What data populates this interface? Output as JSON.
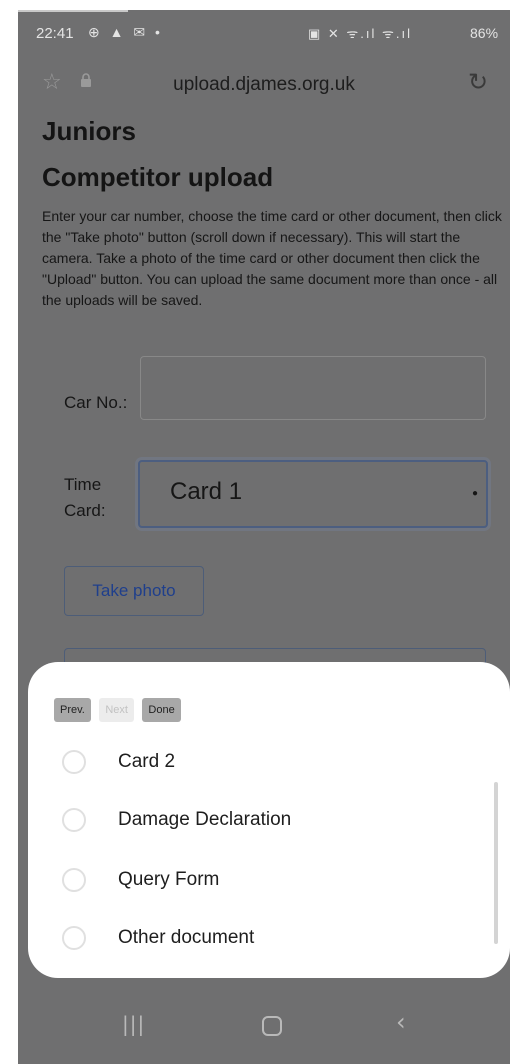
{
  "status_bar": {
    "time": "22:41",
    "left_icons": "⊕ ▲ ✉ •",
    "right_icons": "▣ ✕ ᯤ.ıl ᯤ.ıl",
    "battery": "86%"
  },
  "url_bar": {
    "url": "upload.djames.org.uk",
    "star_icon": "☆",
    "lock_icon": "🔒",
    "reload_icon": "↻"
  },
  "page": {
    "heading": "Juniors",
    "subheading": "Competitor upload",
    "instructions": "Enter your car number, choose the time card or other document, then click the \"Take photo\" button (scroll down if necessary). This will start the camera. Take a photo of the time card or other document then click the \"Upload\" button. You can upload the same document more than once - all the uploads will be saved.",
    "car_label": "Car No.:",
    "car_value": "",
    "card_label": "Time Card:",
    "card_value": "Card 1",
    "take_photo_label": "Take photo"
  },
  "picker": {
    "toolbar": {
      "prev": "Prev.",
      "next": "Next",
      "done": "Done"
    },
    "options": [
      {
        "label": "Card 2",
        "selected": false
      },
      {
        "label": "Damage Declaration",
        "selected": false
      },
      {
        "label": "Query Form",
        "selected": false
      },
      {
        "label": "Other document",
        "selected": false
      }
    ]
  },
  "nav_bar": {
    "recent_icon": "|||",
    "back_icon": "‹"
  }
}
